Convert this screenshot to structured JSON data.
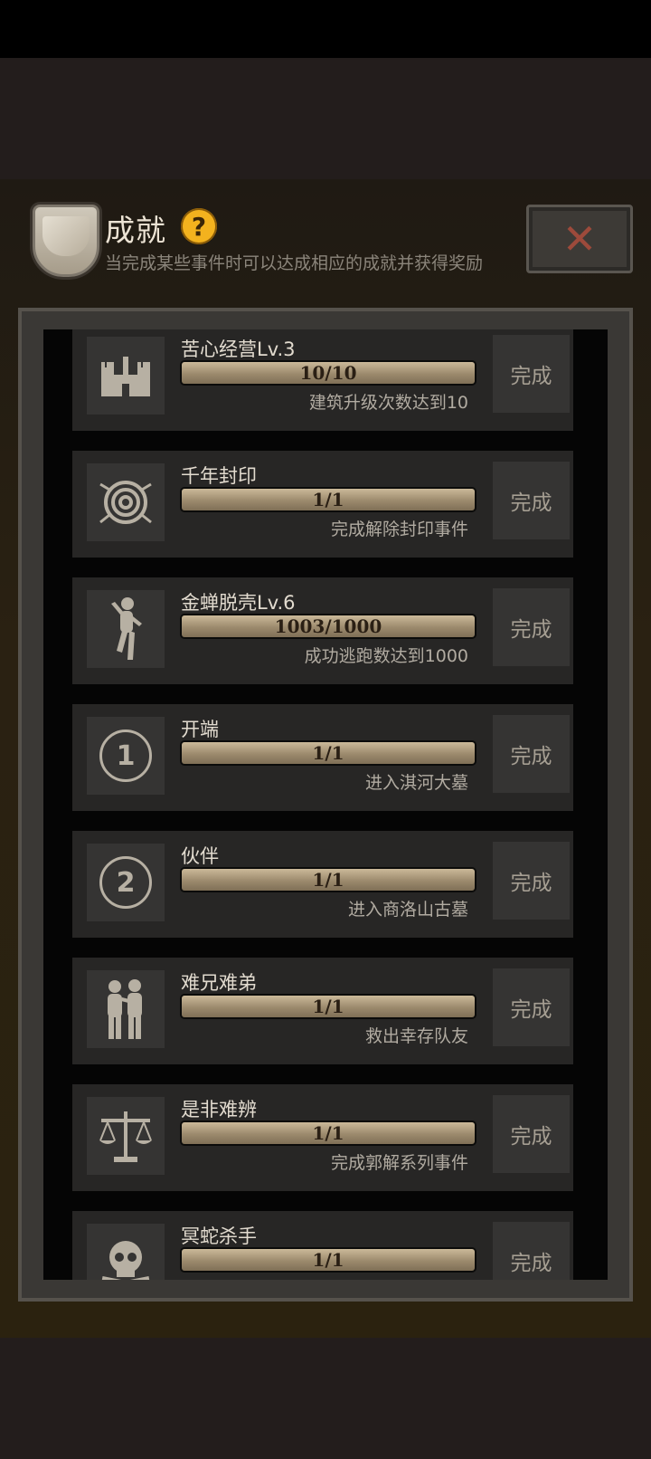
{
  "header": {
    "title": "成就",
    "subtitle": "当完成某些事件时可以达成相应的成就并获得奖励",
    "help_glyph": "?",
    "close_glyph": "✕"
  },
  "achievements": [
    {
      "name": "苦心经营Lv.3",
      "progress": "10/10",
      "progress_fraction": 1.0,
      "desc": "建筑升级次数达到10",
      "status": "完成",
      "icon": "castle-icon"
    },
    {
      "name": "千年封印",
      "progress": "1/1",
      "progress_fraction": 1.0,
      "desc": "完成解除封印事件",
      "status": "完成",
      "icon": "seal-swirl-icon"
    },
    {
      "name": "金蝉脱壳Lv.6",
      "progress": "1003/1000",
      "progress_fraction": 1.0,
      "desc": "成功逃跑数达到1000",
      "status": "完成",
      "icon": "running-man-icon"
    },
    {
      "name": "开端",
      "progress": "1/1",
      "progress_fraction": 1.0,
      "desc": "进入淇河大墓",
      "status": "完成",
      "icon": "number-one-icon",
      "glyph": "1"
    },
    {
      "name": "伙伴",
      "progress": "1/1",
      "progress_fraction": 1.0,
      "desc": "进入商洛山古墓",
      "status": "完成",
      "icon": "number-two-icon",
      "glyph": "2"
    },
    {
      "name": "难兄难弟",
      "progress": "1/1",
      "progress_fraction": 1.0,
      "desc": "救出幸存队友",
      "status": "完成",
      "icon": "two-people-icon"
    },
    {
      "name": "是非难辨",
      "progress": "1/1",
      "progress_fraction": 1.0,
      "desc": "完成郭解系列事件",
      "status": "完成",
      "icon": "scales-icon"
    },
    {
      "name": "冥蛇杀手",
      "progress": "1/1",
      "progress_fraction": 1.0,
      "desc": "",
      "status": "完成",
      "icon": "skull-icon"
    }
  ]
}
